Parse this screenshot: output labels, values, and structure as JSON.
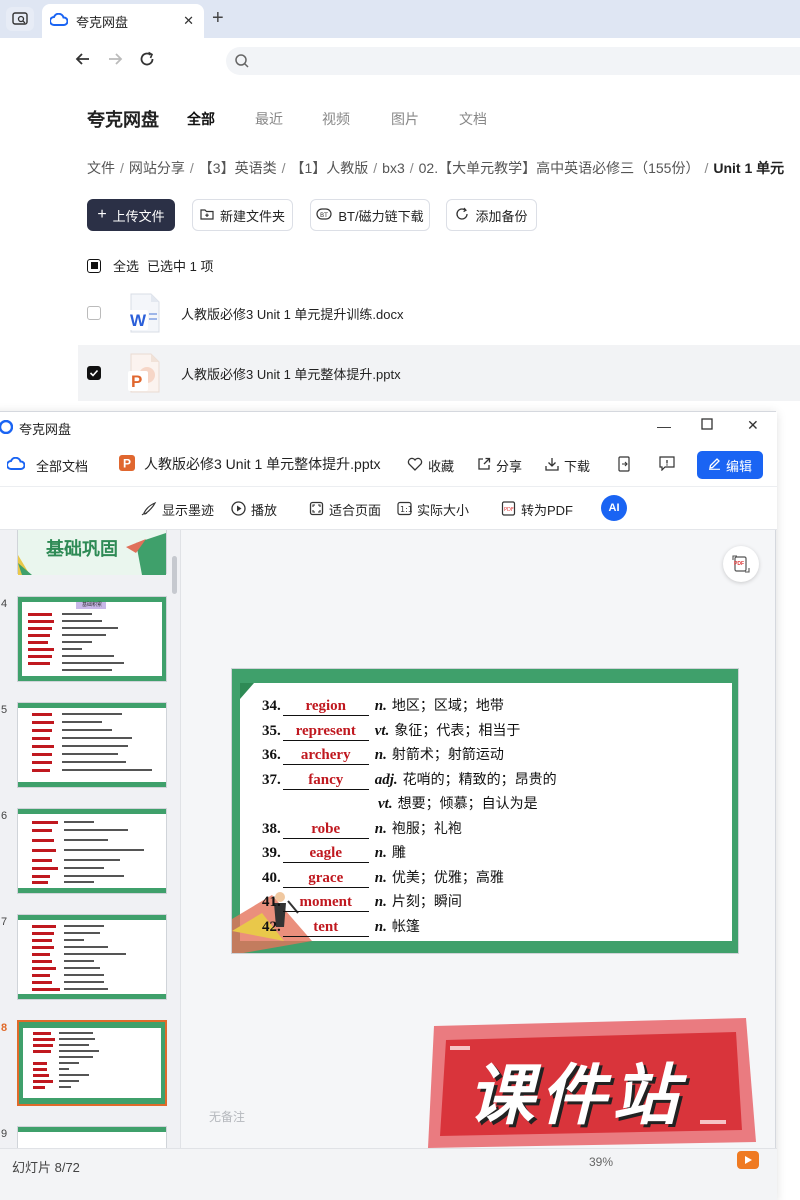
{
  "browser": {
    "tab_title": "夸克网盘",
    "tab_close": "✕",
    "new_tab": "+"
  },
  "app": {
    "logo_text": "夸克网盘",
    "nav_tabs": [
      "全部",
      "最近",
      "视频",
      "图片",
      "文档"
    ],
    "active_tab": "全部"
  },
  "breadcrumb": {
    "items": [
      "文件",
      "网站分享",
      "【3】英语类",
      "【1】人教版",
      "bx3",
      "02.【大单元教学】高中英语必修三（155份）"
    ],
    "current": "Unit 1 单元",
    "separator": "/"
  },
  "actions": {
    "upload": "上传文件",
    "new_folder": "新建文件夹",
    "bt_download": "BT/磁力链下载",
    "add_backup": "添加备份"
  },
  "selection": {
    "select_all": "全选",
    "selected_info": "已选中  1  项"
  },
  "files": [
    {
      "name": "人教版必修3 Unit 1 单元提升训练.docx",
      "type": "docx",
      "selected": false
    },
    {
      "name": "人教版必修3 Unit 1 单元整体提升.pptx",
      "type": "pptx",
      "selected": true
    }
  ],
  "viewer": {
    "window_title": "夸克网盘",
    "all_docs": "全部文档",
    "file_name": "人教版必修3 Unit 1 单元整体提升.pptx",
    "collect": "收藏",
    "share": "分享",
    "download": "下载",
    "edit": "编辑",
    "show_ink": "显示墨迹",
    "play": "播放",
    "fit_page": "适合页面",
    "actual_size": "实际大小",
    "to_pdf": "转为PDF",
    "ai_label": "AI",
    "pdf_label": "PDF",
    "remarks": "无备注",
    "slide_status": "幻灯片 8/72",
    "zoom": "39%"
  },
  "thumbnails": [
    {
      "num": "4",
      "active": false
    },
    {
      "num": "5",
      "active": false
    },
    {
      "num": "6",
      "active": false
    },
    {
      "num": "7",
      "active": false
    },
    {
      "num": "8",
      "active": true
    },
    {
      "num": "9",
      "active": false
    }
  ],
  "thumb_top_text": "基础巩固",
  "thumb_header_label": "基础积累",
  "slide": {
    "entries": [
      {
        "num": "34.",
        "word": "region",
        "pos": "n.",
        "def": "地区；区域；地带"
      },
      {
        "num": "35.",
        "word": "represent",
        "pos": "vt.",
        "def": "象征；代表；相当于"
      },
      {
        "num": "36.",
        "word": "archery",
        "pos": "n.",
        "def": "射箭术；射箭运动"
      },
      {
        "num": "37.",
        "word": "fancy",
        "pos": "adj.",
        "def": "花哨的；精致的；昂贵的"
      },
      {
        "num": "",
        "word": "",
        "pos": "vt.",
        "def": "想要；倾慕；自认为是"
      },
      {
        "num": "38.",
        "word": "robe",
        "pos": "n.",
        "def": "袍服；礼袍"
      },
      {
        "num": "39.",
        "word": "eagle",
        "pos": "n.",
        "def": "雕"
      },
      {
        "num": "40.",
        "word": "grace",
        "pos": "n.",
        "def": "优美；优雅；高雅"
      },
      {
        "num": "41.",
        "word": "moment",
        "pos": "n.",
        "def": "片刻；瞬间"
      },
      {
        "num": "42.",
        "word": "tent",
        "pos": "n.",
        "def": "帐篷"
      }
    ]
  },
  "watermark": {
    "text": "课件站",
    "color": "#d9343b"
  },
  "colors": {
    "accent_blue": "#1a64f3",
    "slide_green": "#3fa06b",
    "answer_red": "#c0181f",
    "primary_dark": "#2b3046"
  }
}
